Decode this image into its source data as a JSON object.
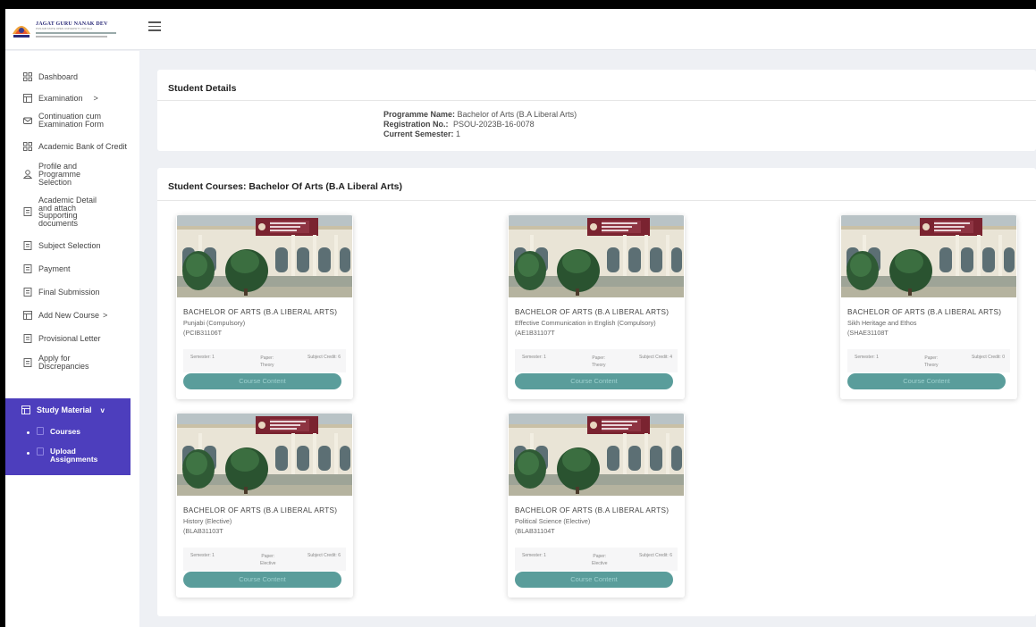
{
  "app": {
    "logo_name": "JAGAT GURU NANAK DEV",
    "logo_subtext": "PUNJAB STATE OPEN UNIVERSITY, PATIALA"
  },
  "sidebar": {
    "items": [
      {
        "label": "Dashboard",
        "icon": "grid-icon"
      },
      {
        "label": "Examination",
        "icon": "table-icon",
        "chevron": ">"
      },
      {
        "label": "Continuation cum Examination Form",
        "icon": "envelope-icon"
      },
      {
        "label": "Academic Bank of Credit",
        "icon": "grid-icon"
      },
      {
        "label": "Profile and Programme Selection",
        "icon": "user-icon"
      },
      {
        "label": "Academic Detail and attach Supporting documents",
        "icon": "document-icon"
      },
      {
        "label": "Subject Selection",
        "icon": "document-icon"
      },
      {
        "label": "Payment",
        "icon": "document-icon"
      },
      {
        "label": "Final Submission",
        "icon": "document-icon"
      },
      {
        "label": "Add New Course",
        "icon": "table-icon",
        "chevron": ">"
      },
      {
        "label": "Provisional Letter",
        "icon": "document-icon"
      },
      {
        "label": "Apply for Discrepancies",
        "icon": "document-icon"
      }
    ],
    "study_material": {
      "label": "Study Material",
      "chevron": "v",
      "children": [
        "Courses",
        "Upload Assignments"
      ]
    }
  },
  "student_details": {
    "title": "Student Details",
    "programme_label": "Programme Name:",
    "programme_value": "Bachelor of Arts (B.A Liberal Arts)",
    "registration_label": "Registration No.:",
    "registration_value": "PSOU-2023B-16-0078",
    "semester_label": "Current Semester:",
    "semester_value": "1"
  },
  "student_courses": {
    "title": "Student Courses: Bachelor Of Arts (B.A Liberal Arts)",
    "cards": [
      {
        "degree": "BACHELOR OF ARTS (B.A LIBERAL ARTS)",
        "subject": "Punjabi (Compulsory)",
        "code": "(PCIB31106T",
        "semester": "Semester: 1",
        "paper_label": "Paper:",
        "paper_value": "Theory",
        "credit": "Subject Credit: 6",
        "button": "Course Content"
      },
      {
        "degree": "BACHELOR OF ARTS (B.A LIBERAL ARTS)",
        "subject": "Effective Communication in English (Compulsory)",
        "code": "(AE1B31107T",
        "semester": "Semester: 1",
        "paper_label": "Paper:",
        "paper_value": "Theory",
        "credit": "Subject Credit: 4",
        "button": "Course Content"
      },
      {
        "degree": "BACHELOR OF ARTS (B.A LIBERAL ARTS)",
        "subject": "Sikh Heritage and Ethos",
        "code": "(SHAE31108T",
        "semester": "Semester: 1",
        "paper_label": "Paper:",
        "paper_value": "Theory",
        "credit": "Subject Credit: 0",
        "button": "Course Content"
      },
      {
        "degree": "BACHELOR OF ARTS (B.A LIBERAL ARTS)",
        "subject": "History (Elective)",
        "code": "(BLAB31103T",
        "semester": "Semester: 1",
        "paper_label": "Paper:",
        "paper_value": "Elective",
        "credit": "Subject Credit: 6",
        "button": "Course Content"
      },
      {
        "degree": "BACHELOR OF ARTS (B.A LIBERAL ARTS)",
        "subject": "Political Science (Elective)",
        "code": "(BLAB31104T",
        "semester": "Semester: 1",
        "paper_label": "Paper:",
        "paper_value": "Elective",
        "credit": "Subject Credit: 6",
        "button": "Course Content"
      }
    ]
  },
  "colors": {
    "accent": "#4d3ebd",
    "button": "#5a9d9b",
    "page_bg": "#eef0f4"
  }
}
